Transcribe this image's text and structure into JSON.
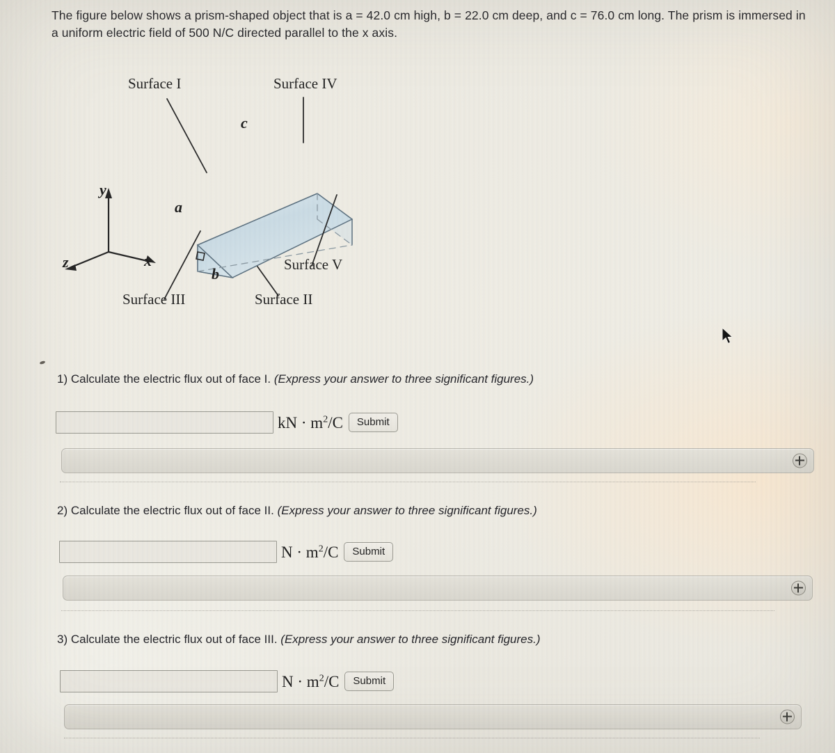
{
  "problem": {
    "statement": "The figure below shows a prism-shaped object that is a = 42.0 cm high, b = 22.0 cm deep, and c = 76.0 cm long. The prism is immersed in a uniform electric field of 500 N/C directed parallel to the x axis.",
    "given": {
      "a_label": "a",
      "a_value": "42.0 cm",
      "b_label": "b",
      "b_value": "22.0 cm",
      "c_label": "c",
      "c_value": "76.0 cm",
      "field_magnitude": "500 N/C",
      "field_direction": "parallel to the x axis"
    }
  },
  "figure": {
    "surface_labels": [
      "Surface I",
      "Surface IV",
      "Surface V",
      "Surface II",
      "Surface III"
    ],
    "dimension_labels": [
      "c",
      "a",
      "b"
    ],
    "axis_labels": [
      "y",
      "x",
      "z"
    ],
    "right_angle_marker": "right-angle-square",
    "body_color": "#c6d8e0",
    "edge_color": "#6e8290"
  },
  "questions": [
    {
      "number": "1)",
      "text": "Calculate the electric flux out of face I. ",
      "instruction": "(Express your answer to three significant figures.)",
      "value": "",
      "unit_prefix": "kN",
      "unit_dot": "·",
      "unit_m": "m",
      "unit_exp": "2",
      "unit_suffix": "/C",
      "submit_label": "Submit"
    },
    {
      "number": "2)",
      "text": "Calculate the electric flux out of face II. ",
      "instruction": "(Express your answer to three significant figures.)",
      "value": "",
      "unit_prefix": "N",
      "unit_dot": "·",
      "unit_m": "m",
      "unit_exp": "2",
      "unit_suffix": "/C",
      "submit_label": "Submit"
    },
    {
      "number": "3)",
      "text": "Calculate the electric flux out of face III. ",
      "instruction": "(Express your answer to three significant figures.)",
      "value": "",
      "unit_prefix": "N",
      "unit_dot": "·",
      "unit_m": "m",
      "unit_exp": "2",
      "unit_suffix": "/C",
      "submit_label": "Submit"
    }
  ],
  "hint_bars": [
    {
      "expand_icon": "plus-circle-icon"
    },
    {
      "expand_icon": "plus-circle-icon"
    },
    {
      "expand_icon": "plus-circle-icon"
    }
  ],
  "colors": {
    "page_background": "#edebe3",
    "text": "#25252a",
    "input_border": "#9a9a92",
    "bar_background": "#dedcd4"
  },
  "cursor": {
    "icon": "mouse-pointer-icon"
  }
}
